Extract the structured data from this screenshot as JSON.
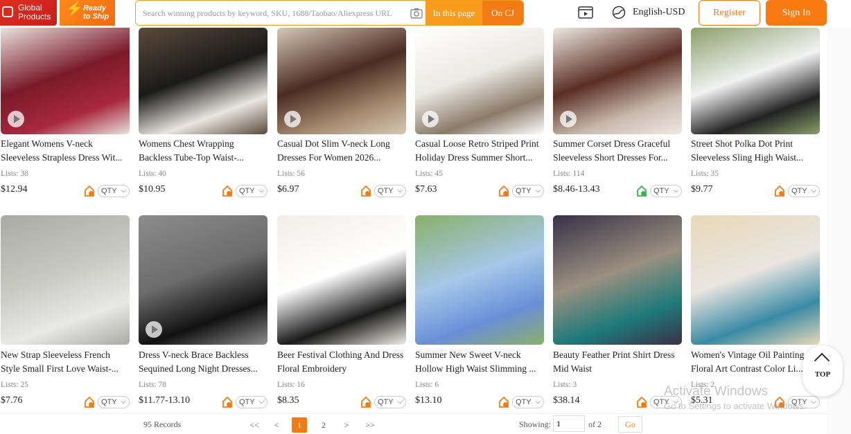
{
  "header": {
    "logo_global": "Global Products",
    "logo_ready": "Ready to Ship",
    "search_placeholder": "Search winning products by keyword, SKU, 1688/Taobao/Aliexpress URL",
    "in_this_page": "In this page",
    "on_cj": "On CJ",
    "language": "English-USD",
    "register": "Register",
    "sign_in": "Sign In"
  },
  "products": [
    {
      "title": "Elegant Womens V-neck Sleeveless Strapless Dress Wit...",
      "lists": "Lists: 38",
      "price": "$12.94",
      "qty": "QTY",
      "verified": false,
      "video": true
    },
    {
      "title": "Womens Chest Wrapping Backless Tube-Top Waist-...",
      "lists": "Lists: 40",
      "price": "$10.95",
      "qty": "QTY",
      "verified": false,
      "video": false
    },
    {
      "title": "Casual Dot Slim V-neck Long Dresses For Women 2026...",
      "lists": "Lists: 56",
      "price": "$6.97",
      "qty": "QTY",
      "verified": false,
      "video": true
    },
    {
      "title": "Casual Loose Retro Striped Print Holiday Dress Summer Short...",
      "lists": "Lists: 45",
      "price": "$7.63",
      "qty": "QTY",
      "verified": false,
      "video": true
    },
    {
      "title": "Summer Corset Dress Graceful Sleeveless Short Dresses For...",
      "lists": "Lists: 114",
      "price": "$8.46-13.43",
      "qty": "QTY",
      "verified": true,
      "video": true
    },
    {
      "title": "Street Shot Polka Dot Print Sleeveless Sling High Waist...",
      "lists": "Lists: 35",
      "price": "$9.77",
      "qty": "QTY",
      "verified": false,
      "video": false
    },
    {
      "title": "New Strap Sleeveless French Style Small First Love Waist-...",
      "lists": "Lists: 25",
      "price": "$7.76",
      "qty": "QTY",
      "verified": false,
      "video": false
    },
    {
      "title": "Dress V-neck Brace Backless Sequined Long Night Dresses...",
      "lists": "Lists: 78",
      "price": "$11.77-13.10",
      "qty": "QTY",
      "verified": false,
      "video": true
    },
    {
      "title": "Beer Festival Clothing And Dress Floral Embroidery",
      "lists": "Lists: 16",
      "price": "$8.35",
      "qty": "QTY",
      "verified": false,
      "video": false
    },
    {
      "title": "Summer New Sweet V-neck Hollow High Waist Slimming ...",
      "lists": "Lists: 6",
      "price": "$13.10",
      "qty": "QTY",
      "verified": false,
      "video": false
    },
    {
      "title": "Beauty Feather Print Shirt Dress Mid Waist",
      "lists": "Lists: 3",
      "price": "$38.14",
      "qty": "QTY",
      "verified": false,
      "video": false
    },
    {
      "title": "Women's Vintage Oil Painting Floral Art Contrast Color Li...",
      "lists": "Lists: 2",
      "price": "$5.31",
      "qty": "QTY",
      "verified": false,
      "video": false
    }
  ],
  "pagination": {
    "records": "95 Records",
    "first": "<<",
    "prev": "<",
    "pages": [
      "1",
      "2"
    ],
    "current_page": "1",
    "next": ">",
    "last": ">>",
    "showing_label": "Showing:",
    "showing_value": "1",
    "of_total": "of 2",
    "go": "Go"
  },
  "top_button": "TOP",
  "watermark": {
    "line1": "Activate Windows",
    "line2": "Go to Settings to activate Windows."
  },
  "colors": {
    "accent": "#f37b14",
    "accent_light": "#f99c1c",
    "logo_red": "#e02d1f",
    "verified_green": "#3bb54a"
  }
}
